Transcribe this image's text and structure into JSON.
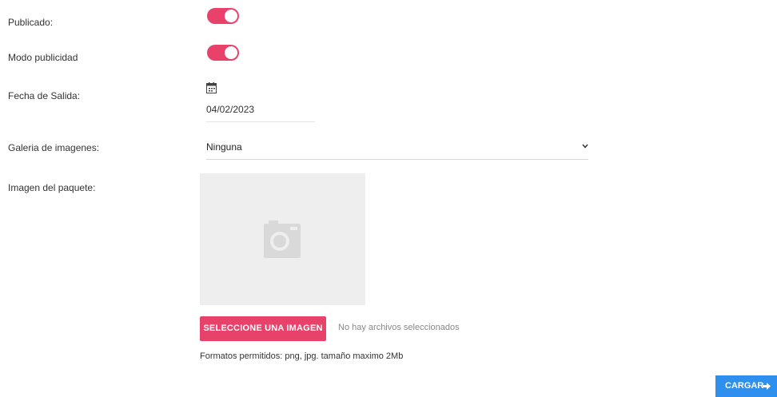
{
  "form": {
    "published": {
      "label": "Publicado:",
      "on": true
    },
    "ad_mode": {
      "label": "Modo publicidad",
      "on": true
    },
    "release_date": {
      "label": "Fecha de Salida:",
      "value": "04/02/2023"
    },
    "gallery": {
      "label": "Galeria de imagenes:",
      "selected": "Ninguna"
    },
    "package_image": {
      "label": "Imagen del paquete:",
      "select_button": "SELECCIONE UNA IMAGEN",
      "no_file_text": "No hay archivos seleccionados",
      "formats_text": "Formatos permitidos: png, jpg. tamaño maximo 2Mb"
    },
    "submit_label": "CARGAR"
  },
  "colors": {
    "accent_pink": "#e8416a",
    "primary_blue": "#2f8fef",
    "placeholder_bg": "#eeeeee"
  },
  "icons": [
    "calendar-icon",
    "chevron-down-icon",
    "camera-icon",
    "arrow-right-icon"
  ]
}
